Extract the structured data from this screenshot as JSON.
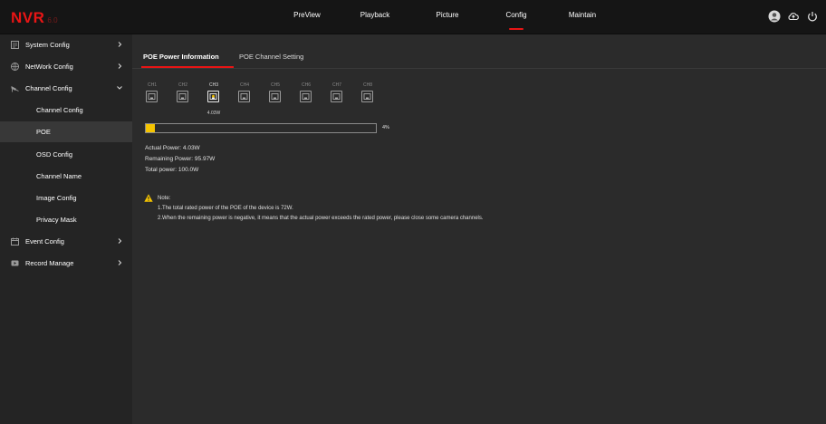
{
  "app": {
    "logo": "NVR",
    "version": "6.0"
  },
  "nav": [
    {
      "label": "PreView",
      "active": false
    },
    {
      "label": "Playback",
      "active": false
    },
    {
      "label": "Picture",
      "active": false
    },
    {
      "label": "Config",
      "active": true
    },
    {
      "label": "Maintain",
      "active": false
    }
  ],
  "top_icons": [
    "user-avatar-icon",
    "cloud-upload-icon",
    "power-icon"
  ],
  "sidebar": {
    "items": [
      {
        "label": "System Config",
        "icon": "system-config-icon",
        "arrow": "chevron-right"
      },
      {
        "label": "NetWork Config",
        "icon": "network-icon",
        "arrow": "chevron-right"
      },
      {
        "label": "Channel Config",
        "icon": "camera-icon",
        "arrow": "chevron-down",
        "expanded": true
      },
      {
        "label": "Event Config",
        "icon": "event-icon",
        "arrow": "chevron-right"
      },
      {
        "label": "Record Manage",
        "icon": "record-icon",
        "arrow": "chevron-right"
      }
    ],
    "sub_items": [
      {
        "label": "Channel Config",
        "active": false
      },
      {
        "label": "POE",
        "active": true
      },
      {
        "label": "OSD Config",
        "active": false
      },
      {
        "label": "Channel Name",
        "active": false
      },
      {
        "label": "Image Config",
        "active": false
      },
      {
        "label": "Privacy Mask",
        "active": false
      }
    ]
  },
  "tabs": [
    {
      "label": "POE Power Information",
      "active": true
    },
    {
      "label": "POE Channel Setting",
      "active": false
    }
  ],
  "channels": [
    {
      "label": "CH1",
      "connected": false,
      "power": ""
    },
    {
      "label": "CH2",
      "connected": false,
      "power": ""
    },
    {
      "label": "CH3",
      "connected": true,
      "power": "4.03W"
    },
    {
      "label": "CH4",
      "connected": false,
      "power": ""
    },
    {
      "label": "CH5",
      "connected": false,
      "power": ""
    },
    {
      "label": "CH6",
      "connected": false,
      "power": ""
    },
    {
      "label": "CH7",
      "connected": false,
      "power": ""
    },
    {
      "label": "CH8",
      "connected": false,
      "power": ""
    }
  ],
  "power_usage": {
    "percent": 4,
    "percent_label": "4%"
  },
  "info": {
    "actual": "Actual Power:  4.03W",
    "remaining": "Remaining Power: 95.97W",
    "total": "Total power:   100.0W"
  },
  "note": {
    "title": "Note:",
    "lines": [
      "1.The total rated power of the POE of the device is 72W.",
      "2.When the remaining power is negative, it means that the actual power exceeds the rated power, please close some camera channels."
    ]
  },
  "colors": {
    "accent": "#e81515",
    "bar_fill": "#f5c400",
    "main_bg": "#2b2b2b",
    "sidebar_bg": "#242424",
    "topbar_bg": "#151515",
    "warning": "#f5c400"
  }
}
